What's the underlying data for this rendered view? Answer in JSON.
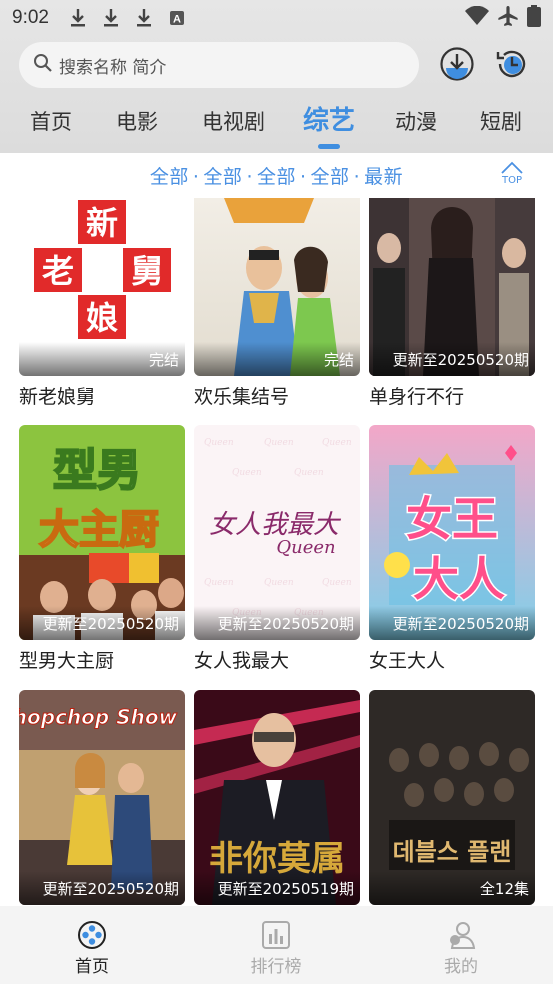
{
  "status": {
    "time": "9:02",
    "left_icons": [
      "download-icon",
      "download-icon",
      "download-icon",
      "a-notification-icon"
    ],
    "right_icons": [
      "wifi-icon",
      "airplane-icon",
      "battery-icon"
    ]
  },
  "search": {
    "placeholder": "搜索名称 简介"
  },
  "header_buttons": [
    "download-manager-icon",
    "history-icon"
  ],
  "tabs": [
    {
      "label": "首页"
    },
    {
      "label": "电影"
    },
    {
      "label": "电视剧"
    },
    {
      "label": "综艺"
    },
    {
      "label": "动漫"
    },
    {
      "label": "短剧"
    }
  ],
  "active_tab": "综艺",
  "filter": {
    "items": [
      "全部",
      "全部",
      "全部",
      "全部",
      "最新"
    ],
    "top_label": "TOP"
  },
  "shows": [
    {
      "title": "新老娘舅",
      "badge": "完结"
    },
    {
      "title": "欢乐集结号",
      "badge": "完结"
    },
    {
      "title": "单身行不行",
      "badge": "更新至20250520期"
    },
    {
      "title": "型男大主厨",
      "badge": "更新至20250520期"
    },
    {
      "title": "女人我最大",
      "badge": "更新至20250520期"
    },
    {
      "title": "女王大人",
      "badge": "更新至20250520期"
    },
    {
      "title": "",
      "badge": "更新至20250520期"
    },
    {
      "title": "",
      "badge": "更新至20250519期"
    },
    {
      "title": "",
      "badge": "全12集"
    }
  ],
  "poster_text": {
    "p1_chars": [
      "新",
      "老",
      "舅",
      "娘"
    ],
    "p4_top": "型男",
    "p4_bottom": "大主厨",
    "p5_logo": "女人我最大",
    "p5_sub": "Queen",
    "p6_top": "女王",
    "p6_bottom": "大人",
    "p7_logo": "chopchop Show",
    "p8_logo": "非你莫属",
    "p9_logo": "데블스 플랜"
  },
  "bottom_nav": [
    {
      "label": "首页",
      "icon": "home-controller-icon",
      "active": true
    },
    {
      "label": "排行榜",
      "icon": "chart-icon",
      "active": false
    },
    {
      "label": "我的",
      "icon": "profile-icon",
      "active": false
    }
  ],
  "colors": {
    "accent": "#3f8ee0",
    "filter": "#4a90e2"
  }
}
